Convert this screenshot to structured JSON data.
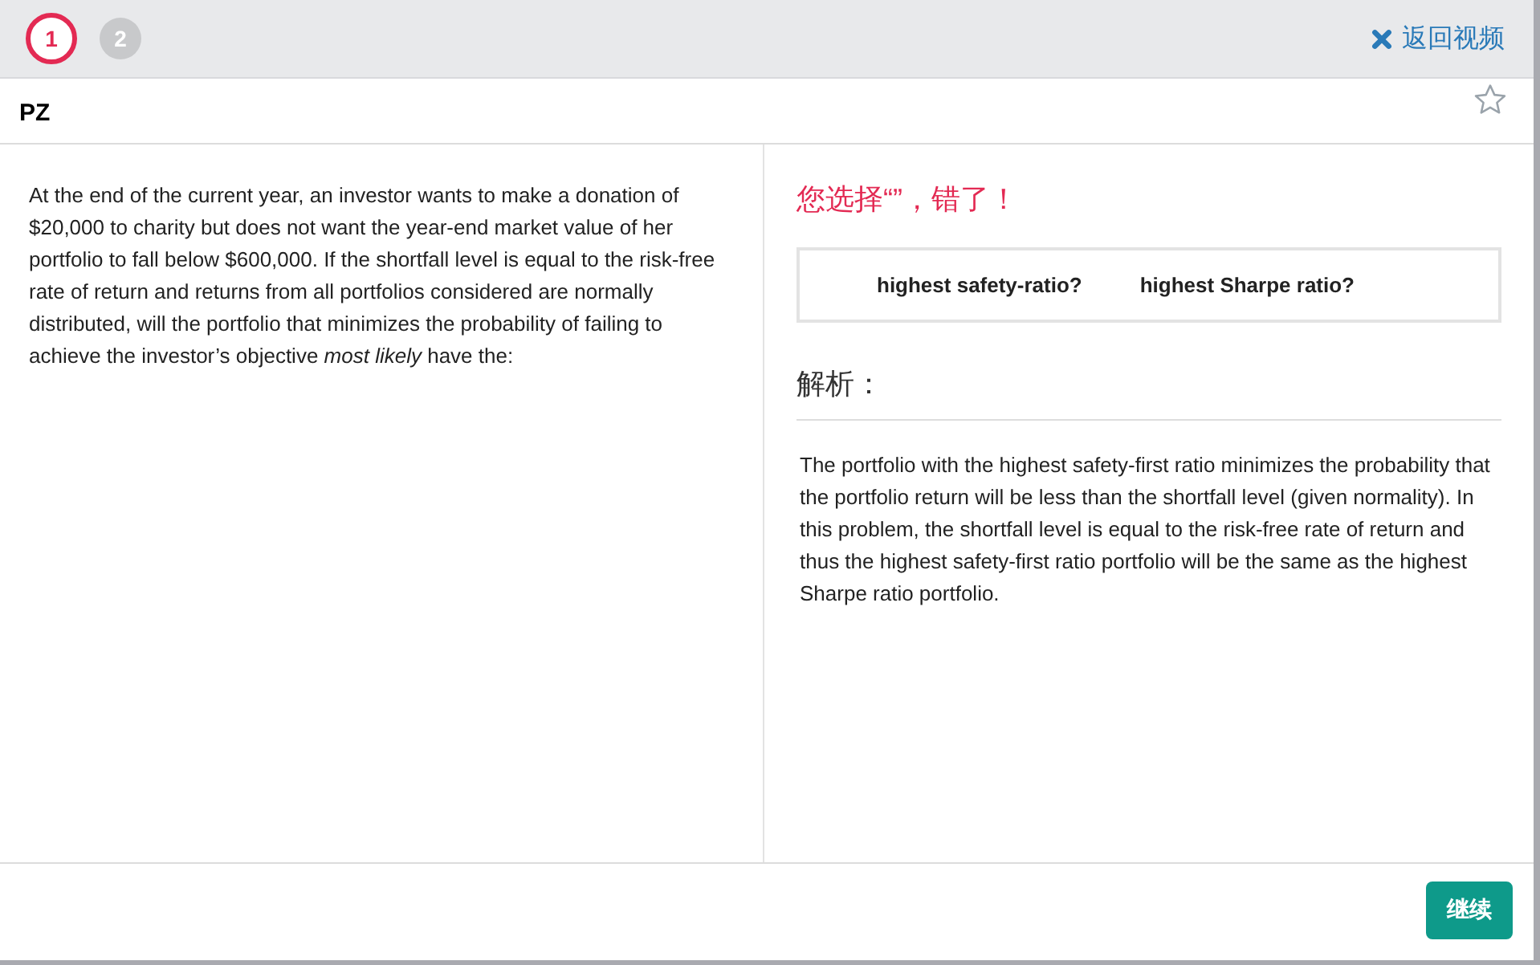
{
  "steps": [
    {
      "label": "1",
      "selected": true
    },
    {
      "label": "2",
      "selected": false
    }
  ],
  "back_link": {
    "label": "返回视频"
  },
  "question": {
    "title": "PZ",
    "favorited": false,
    "text": "At the end of the current year, an investor wants to make a donation of $20,000 to charity but does not want the year-end market value of her portfolio to fall below $600,000. If the shortfall level is equal to the risk-free rate of return and returns from all portfolios considered are normally distributed, will the portfolio that minimizes the probability of failing to achieve the investor’s objective *most likely* have the:"
  },
  "result": {
    "message": "您选择“”，错了！",
    "options": [
      "highest safety-ratio?",
      "highest Sharpe ratio?"
    ]
  },
  "explanation": {
    "heading": "解析：",
    "text": "The portfolio with the highest safety-first ratio minimizes the probability that the portfolio return will be less than the shortfall level (given normality). In this problem, the shortfall level is equal to the risk-free rate of return and thus the highest safety-first ratio portfolio will be the same as the highest Sharpe ratio portfolio."
  },
  "continue_button": {
    "label": "继续"
  }
}
